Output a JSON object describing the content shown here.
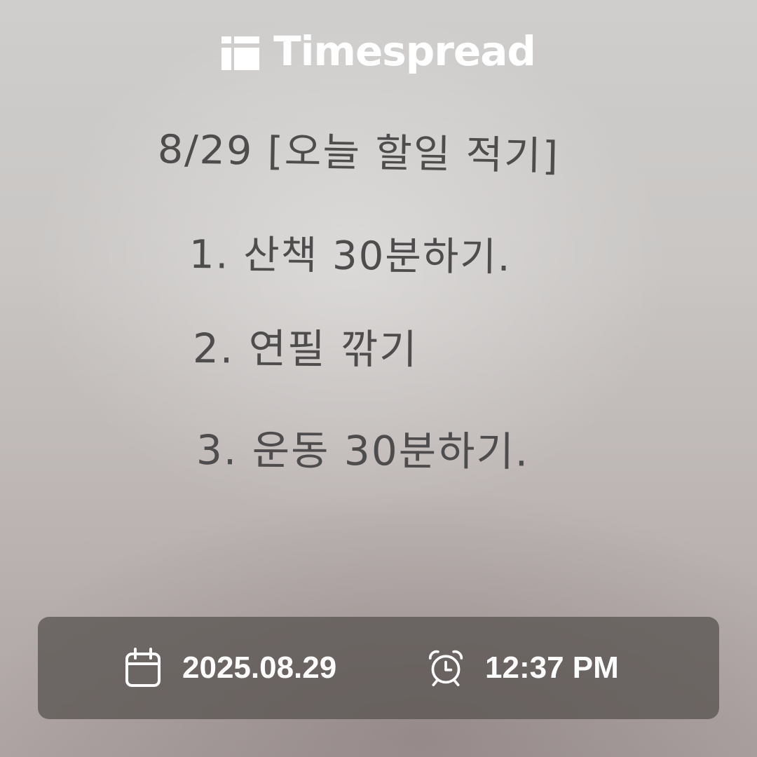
{
  "brand": {
    "name": "Timespread",
    "logo_icon": "timespread-logo-icon"
  },
  "note": {
    "title": "8/29 [오늘 할일 적기]",
    "items": [
      "1. 산책 30분하기.",
      "2. 연필 깎기",
      "3. 운동 30분하기."
    ]
  },
  "info_bar": {
    "date_icon": "calendar-icon",
    "date": "2025.08.29",
    "time_icon": "alarm-clock-icon",
    "time": "12:37 PM"
  },
  "colors": {
    "ink": "#4e4c4c",
    "bar_background": "#5a5452",
    "text_white": "#ffffff"
  }
}
